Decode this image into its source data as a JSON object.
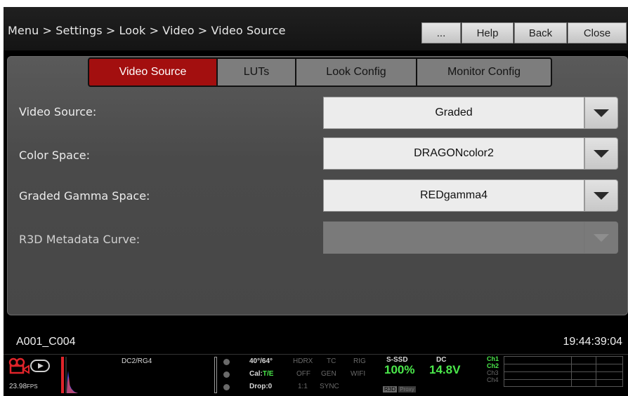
{
  "header": {
    "breadcrumb": "Menu > Settings > Look > Video > Video Source",
    "more_label": "...",
    "help_label": "Help",
    "back_label": "Back",
    "close_label": "Close"
  },
  "tabs": [
    {
      "label": "Video Source",
      "active": true
    },
    {
      "label": "LUTs",
      "active": false
    },
    {
      "label": "Look Config",
      "active": false
    },
    {
      "label": "Monitor Config",
      "active": false
    }
  ],
  "settings": [
    {
      "label": "Video Source:",
      "value": "Graded",
      "enabled": true
    },
    {
      "label": "Color Space:",
      "value": "DRAGONcolor2",
      "enabled": true
    },
    {
      "label": "Graded Gamma Space:",
      "value": "REDgamma4",
      "enabled": true
    },
    {
      "label": "R3D Metadata Curve:",
      "value": "",
      "enabled": false
    }
  ],
  "status": {
    "clip_name": "A001_C004",
    "timecode": "19:44:39:04",
    "fps": "23.98",
    "fps_unit": "FPS",
    "look": "DC2/RG4",
    "temp": "40°/64°",
    "cal_label": "Cal:",
    "cal_value": "T/E",
    "drop": "Drop:0",
    "hdrx": "HDRX",
    "hdrx_state": "OFF",
    "ratio": "1:1",
    "tc": "TC",
    "tc_state": "GEN",
    "sync": "SYNC",
    "rig": "RIG",
    "wifi": "WIFI",
    "media_label": "S-SSD",
    "media_value": "100%",
    "media_tag1": "R3D",
    "media_tag2": "Proxy",
    "power_label": "DC",
    "power_value": "14.8V",
    "ch1": "Ch1",
    "ch2": "Ch2",
    "ch3": "Ch3",
    "ch4": "Ch4"
  },
  "colors": {
    "active_tab": "#a30f0f",
    "ok_green": "#4be84b",
    "rec_red": "#e0242a"
  },
  "icons": [
    "camera-icon",
    "play-icon"
  ]
}
